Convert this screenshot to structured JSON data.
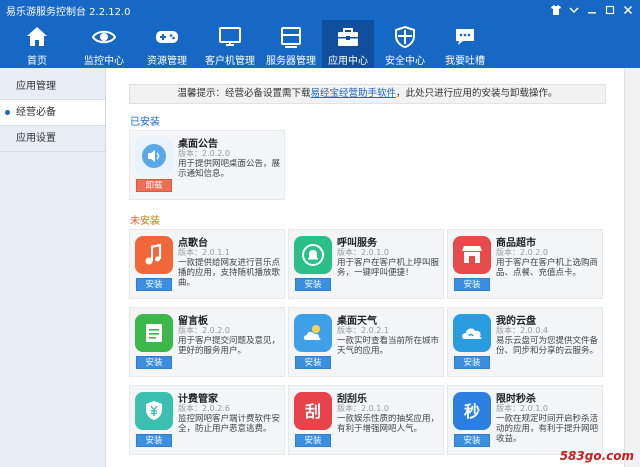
{
  "window": {
    "title": "易乐游服务控制台 2.2.12.0"
  },
  "nav": {
    "items": [
      {
        "label": "首页",
        "icon": "home-icon"
      },
      {
        "label": "监控中心",
        "icon": "eye-icon"
      },
      {
        "label": "资源管理",
        "icon": "gamepad-icon"
      },
      {
        "label": "客户机管理",
        "icon": "monitor-icon"
      },
      {
        "label": "服务器管理",
        "icon": "server-icon"
      },
      {
        "label": "应用中心",
        "icon": "toolbox-icon"
      },
      {
        "label": "安全中心",
        "icon": "shield-icon"
      },
      {
        "label": "我要吐槽",
        "icon": "chat-icon"
      }
    ],
    "active": "应用中心"
  },
  "sidebar": {
    "items": [
      {
        "label": "应用管理"
      },
      {
        "label": "经营必备"
      },
      {
        "label": "应用设置"
      }
    ],
    "active": "经营必备"
  },
  "notice": {
    "prefix": "温馨提示：经营必备设置需下载",
    "link": "易经宝经营助手软件",
    "suffix": "，此处只进行应用的安装与卸载操作。"
  },
  "sections": {
    "installed": "已安装",
    "not_installed": "未安装"
  },
  "installed_apps": [
    {
      "name": "桌面公告",
      "version": "版本：2.0.2.0",
      "desc": "用于提供网吧桌面公告，展示通知信息。",
      "button": "卸载",
      "color": "#5aa8e8"
    }
  ],
  "apps": [
    {
      "name": "点歌台",
      "version": "版本：2.0.1.1",
      "desc": "一款提供给网友进行音乐点播的应用，支持随机播放歌曲。",
      "button": "安装",
      "color": "#f2673a"
    },
    {
      "name": "呼叫服务",
      "version": "版本：2.0.1.0",
      "desc": "用于客户在客户机上呼叫服务，一键呼叫便捷！",
      "button": "安装",
      "color": "#2bbf8a"
    },
    {
      "name": "商品超市",
      "version": "版本：2.0.2.0",
      "desc": "用于客户在客户机上选购商品、点餐、充值点卡。",
      "button": "安装",
      "color": "#e84a4a"
    },
    {
      "name": "留言板",
      "version": "版本：2.0.2.0",
      "desc": "用于客户提交问题及意见，更好的服务用户。",
      "button": "安装",
      "color": "#3cb84a"
    },
    {
      "name": "桌面天气",
      "version": "版本：2.0.2.1",
      "desc": "一款实时查看当前所在城市天气的应用。",
      "button": "安装",
      "color": "#3ea0e8"
    },
    {
      "name": "我的云盘",
      "version": "版本：2.0.0.4",
      "desc": "易乐云盘可为您提供文件备份、同步和分享的云服务。",
      "button": "安装",
      "color": "#2a9de0"
    },
    {
      "name": "计费管家",
      "version": "版本：2.0.2.6",
      "desc": "监控网吧客户端计费软件安全，防止用户恶意逃费。",
      "button": "安装",
      "color": "#3cbfae"
    },
    {
      "name": "刮刮乐",
      "version": "版本：2.0.1.0",
      "desc": "一款娱乐性质的抽奖应用，有利于增强网吧人气。",
      "button": "安装",
      "color": "#e8434b"
    },
    {
      "name": "限时秒杀",
      "version": "版本：2.0.1.0",
      "desc": "一款在规定时间开启秒杀活动的应用，有利于提升网吧收益。",
      "button": "安装",
      "color": "#2a7fe0"
    }
  ],
  "watermark": "583go.com"
}
